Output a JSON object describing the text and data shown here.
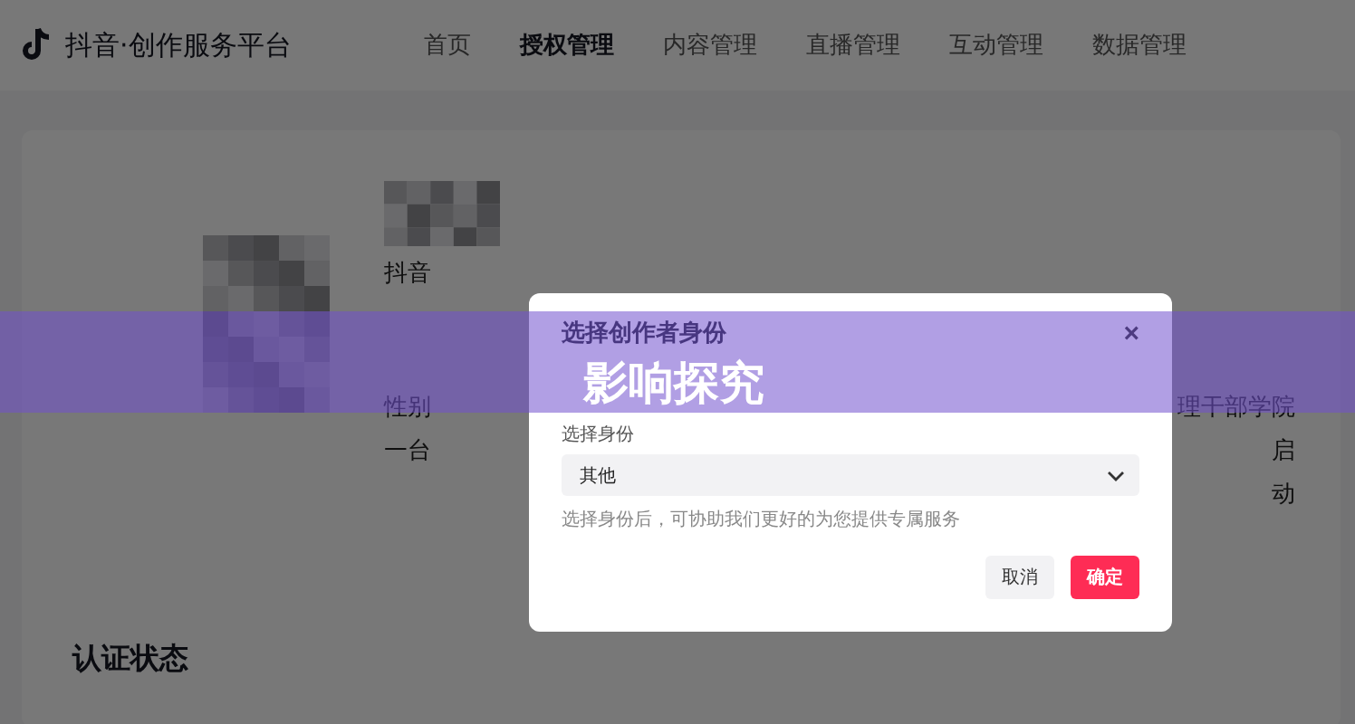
{
  "header": {
    "logo": "抖音·创作服务平台",
    "nav": [
      {
        "label": "首页",
        "selected": false
      },
      {
        "label": "授权管理",
        "selected": true
      },
      {
        "label": "内容管理",
        "selected": false
      },
      {
        "label": "直播管理",
        "selected": false
      },
      {
        "label": "互动管理",
        "selected": false
      },
      {
        "label": "数据管理",
        "selected": false
      }
    ]
  },
  "profile": {
    "lines": [
      {
        "left": "抖音"
      },
      {
        "left": "性别",
        "right": "理干部学院"
      },
      {
        "left": "一台",
        "right": "启"
      },
      {
        "right": "动"
      }
    ]
  },
  "section_title": "认证状态",
  "modal": {
    "title": "选择创作者身份",
    "close": "×",
    "field_label": "选择身份",
    "select_value": "其他",
    "hint": "选择身份后，可协助我们更好的为您提供专属服务",
    "buttons": [
      {
        "label": "取消",
        "kind": "secondary"
      },
      {
        "label": "确定",
        "kind": "primary"
      }
    ]
  },
  "banner": {
    "text": "影响探究"
  }
}
